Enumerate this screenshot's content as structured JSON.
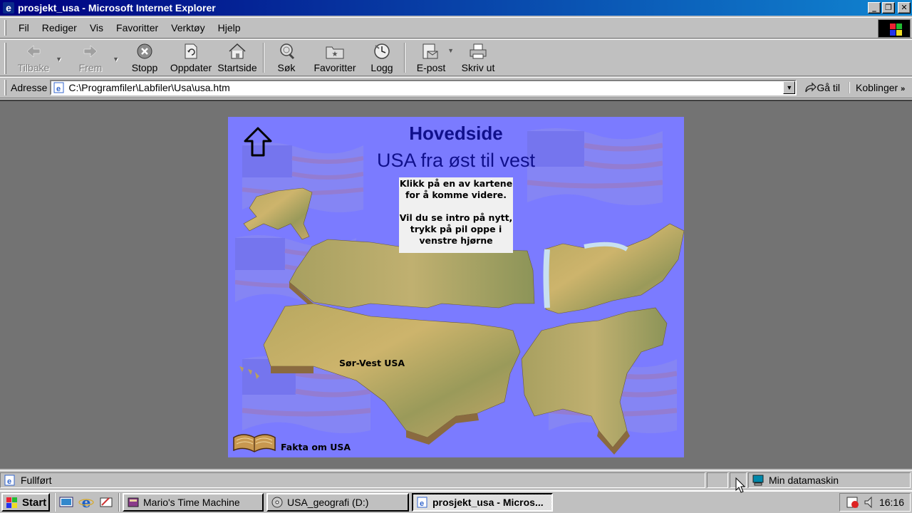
{
  "window": {
    "title": "prosjekt_usa - Microsoft Internet Explorer"
  },
  "menu": {
    "items": [
      {
        "label": "Fil"
      },
      {
        "label": "Rediger"
      },
      {
        "label": "Vis"
      },
      {
        "label": "Favoritter"
      },
      {
        "label": "Verktøy"
      },
      {
        "label": "Hjelp"
      }
    ]
  },
  "toolbar": {
    "back": "Tilbake",
    "forward": "Frem",
    "stop": "Stopp",
    "refresh": "Oppdater",
    "home": "Startside",
    "search": "Søk",
    "favorites": "Favoritter",
    "history": "Logg",
    "mail": "E-post",
    "print": "Skriv ut"
  },
  "address": {
    "label": "Adresse",
    "url": "C:\\Programfiler\\Labfiler\\Usa\\usa.htm",
    "go": "Gå til",
    "links": "Koblinger"
  },
  "page": {
    "heading": "Hovedside",
    "subheading": "USA fra øst til vest",
    "info_line1": "Klikk på en av kartene for å komme videre.",
    "info_line2": "Vil du se intro på nytt, trykk på pil oppe i venstre hjørne",
    "region_southwest": "Sør-Vest USA",
    "facts_link": "Fakta om USA",
    "colors": {
      "background": "#7b7bff",
      "heading": "#10108c"
    }
  },
  "status": {
    "text": "Fullført",
    "zone": "Min datamaskin"
  },
  "taskbar": {
    "start": "Start",
    "tasks": [
      {
        "label": "Mario's Time Machine"
      },
      {
        "label": "USA_geografi (D:)"
      },
      {
        "label": "prosjekt_usa - Micros..."
      }
    ],
    "clock": "16:16"
  }
}
